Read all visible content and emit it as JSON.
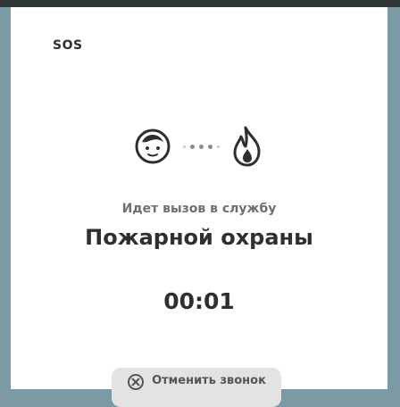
{
  "header": {
    "sos_label": "SOS"
  },
  "call": {
    "status_text": "Идет вызов в службу",
    "service_name": "Пожарной охраны",
    "timer": "00:01",
    "cancel_label": "Отменить звонок"
  },
  "icons": {
    "caller": "user-face-icon",
    "service": "fire-flame-icon",
    "cancel": "cancel-circle-icon"
  },
  "colors": {
    "background": "#7b9aa6",
    "card": "#ffffff",
    "text_dark": "#2f2f2f",
    "text_muted": "#6f6f6f",
    "button_bg": "#e3e3e3"
  }
}
